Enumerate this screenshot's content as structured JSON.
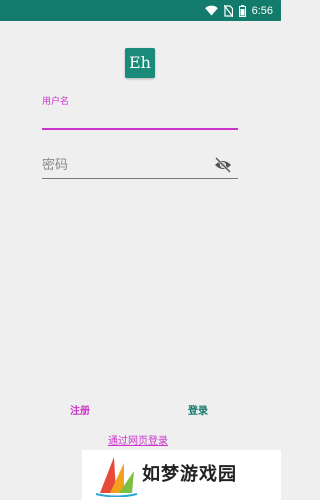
{
  "status_bar": {
    "time": "6:56",
    "icons": [
      "wifi-icon",
      "no-sim-icon",
      "battery-icon"
    ]
  },
  "app": {
    "logo_text": "Eh",
    "brand_color": "#137b6c",
    "accent_color": "#cc33cc"
  },
  "form": {
    "username_label": "用户名",
    "username_value": "",
    "password_placeholder": "密码",
    "password_value": ""
  },
  "actions": {
    "register_label": "注册",
    "login_label": "登录",
    "web_login_label": "通过网页登录"
  },
  "watermark": {
    "text": "如梦游戏园"
  }
}
